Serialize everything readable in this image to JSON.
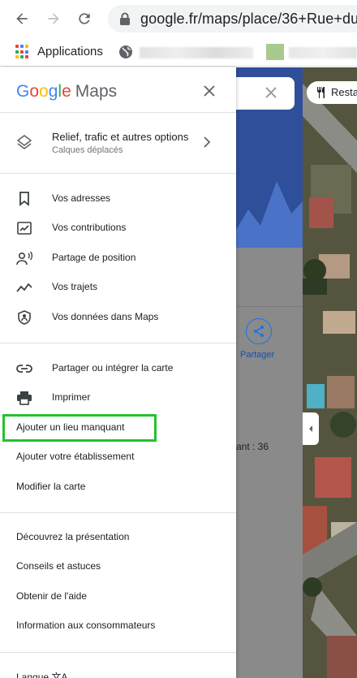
{
  "browser": {
    "url": "google.fr/maps/place/36+Rue+du+",
    "bookmarks": {
      "apps_label": "Applications"
    }
  },
  "drawer": {
    "logo_letters": [
      "G",
      "o",
      "o",
      "g",
      "l",
      "e"
    ],
    "logo_suffix": "Maps",
    "layers": {
      "title": "Relief, trafic et autres options",
      "subtitle": "Calques déplacés"
    },
    "section1": [
      {
        "label": "Vos adresses",
        "icon": "bookmark-icon"
      },
      {
        "label": "Vos contributions",
        "icon": "contributions-icon"
      },
      {
        "label": "Partage de position",
        "icon": "location-sharing-icon"
      },
      {
        "label": "Vos trajets",
        "icon": "timeline-icon"
      },
      {
        "label": "Vos données dans Maps",
        "icon": "shield-icon"
      }
    ],
    "section2": [
      {
        "label": "Partager ou intégrer la carte",
        "icon": "link-icon"
      },
      {
        "label": "Imprimer",
        "icon": "printer-icon"
      },
      {
        "label": "Ajouter un lieu manquant"
      },
      {
        "label": "Ajouter votre établissement"
      },
      {
        "label": "Modifier la carte"
      }
    ],
    "section3": [
      {
        "label": "Découvrez la présentation"
      },
      {
        "label": "Conseils et astuces"
      },
      {
        "label": "Obtenir de l'aide"
      },
      {
        "label": "Information aux consommateurs"
      }
    ],
    "section4": [
      {
        "label": "Langue 文A"
      }
    ]
  },
  "background": {
    "share_label": "Partager",
    "text_fragment": "ant : 36",
    "restaurant_chip": "Resta"
  },
  "colors": {
    "highlight": "#22c32e",
    "accent": "#1a73e8"
  }
}
